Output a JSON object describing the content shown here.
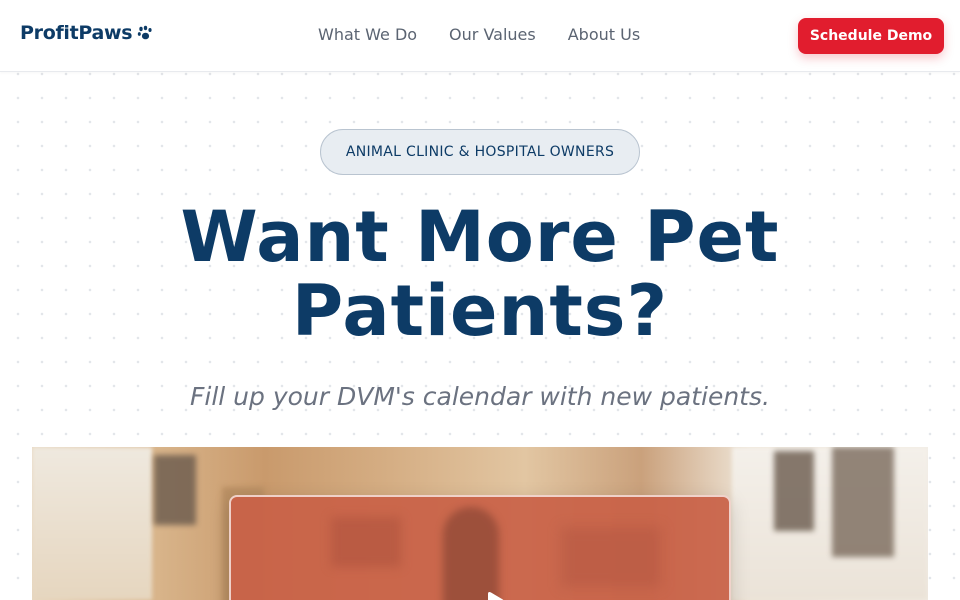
{
  "header": {
    "logo_text": "ProfitPaws",
    "logo_icon": "paw-icon",
    "nav": [
      {
        "label": "What We Do"
      },
      {
        "label": "Our Values"
      },
      {
        "label": "About Us"
      }
    ],
    "cta_label": "Schedule Demo"
  },
  "hero": {
    "badge": "ANIMAL CLINIC & HOSPITAL OWNERS",
    "headline_line1": "Want More Pet",
    "headline_line2": "Patients?",
    "subheadline": "Fill up your DVM's calendar with new patients."
  },
  "media": {
    "play_icon": "play-icon"
  },
  "colors": {
    "brand_navy": "#0d3b66",
    "cta_red": "#e11d2e",
    "overlay_terracotta": "#c96146"
  }
}
